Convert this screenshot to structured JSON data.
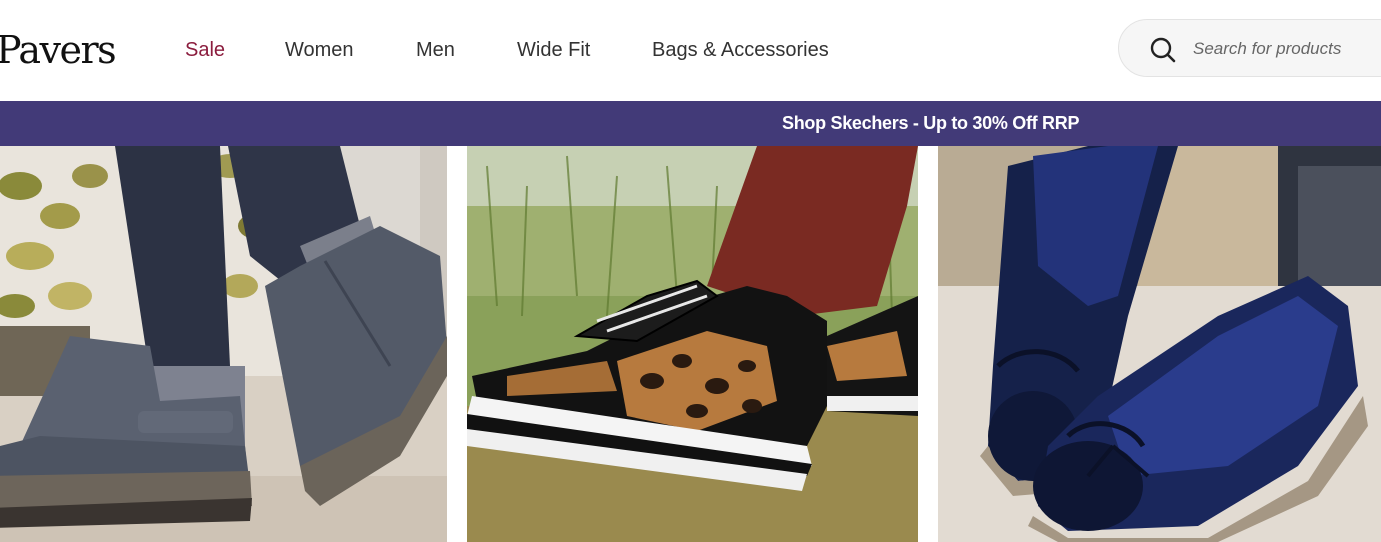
{
  "brand": {
    "logo_text": "Pavers"
  },
  "nav": {
    "items": [
      {
        "label": "Sale",
        "highlight": true
      },
      {
        "label": "Women"
      },
      {
        "label": "Men"
      },
      {
        "label": "Wide Fit"
      },
      {
        "label": "Bags & Accessories"
      }
    ]
  },
  "search": {
    "placeholder": "Search for products",
    "value": "",
    "icon": "search-icon"
  },
  "banner": {
    "text": "Shop Skechers - Up to 30% Off RRP"
  },
  "colors": {
    "banner_bg": "#423a78",
    "sale_text": "#8b1d3e"
  },
  "tiles": [
    {
      "image": "grey ankle boots on paving with ivy"
    },
    {
      "image": "leopard print patent trainers on grass"
    },
    {
      "image": "navy patent bow ballerina flats"
    }
  ]
}
